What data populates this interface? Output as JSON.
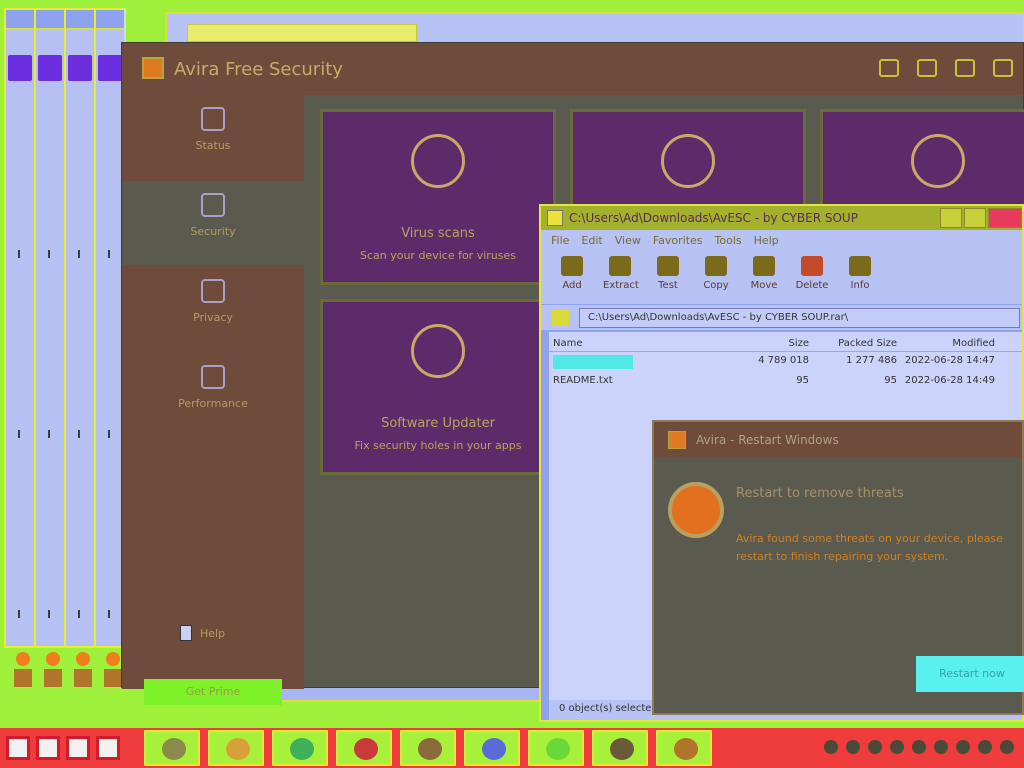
{
  "background_window": {
    "tab_title": "",
    "status_line": ""
  },
  "avira": {
    "title": "Avira Free Security",
    "nav": [
      {
        "label": "Status",
        "icon": "search-shield-icon"
      },
      {
        "label": "Security",
        "icon": "shield-icon"
      },
      {
        "label": "Privacy",
        "icon": "fingerprint-icon"
      },
      {
        "label": "Performance",
        "icon": "rocket-icon"
      }
    ],
    "help_label": "Help",
    "upgrade_label": "Get Prime",
    "tiles": [
      {
        "title": "Virus scans",
        "subtitle": "Scan your device for viruses",
        "icon": "magnifier-check-icon"
      },
      {
        "title": "",
        "subtitle": "",
        "icon": "hexagons-icon"
      },
      {
        "title": "",
        "subtitle": "",
        "icon": "firewall-icon"
      },
      {
        "title": "Software Updater",
        "subtitle": "Fix security holes in your apps",
        "icon": "refresh-icon"
      }
    ]
  },
  "file_manager": {
    "title": "C:\\Users\\Ad\\Downloads\\AvESC - by CYBER SOUP",
    "menu": [
      "File",
      "Edit",
      "View",
      "Favorites",
      "Tools",
      "Help"
    ],
    "tools": [
      {
        "label": "Add",
        "icon": "plus-icon",
        "color": "#6b4a1a"
      },
      {
        "label": "Extract",
        "icon": "minus-icon",
        "color": "#6b4a1a"
      },
      {
        "label": "Test",
        "icon": "check-icon",
        "color": "#6b4a1a"
      },
      {
        "label": "Copy",
        "icon": "arrow-copy-icon",
        "color": "#6b4a1a"
      },
      {
        "label": "Move",
        "icon": "arrow-move-icon",
        "color": "#6b4a1a"
      },
      {
        "label": "Delete",
        "icon": "delete-x-icon",
        "color": "#c44a2a"
      },
      {
        "label": "Info",
        "icon": "info-icon",
        "color": "#6b4a1a"
      }
    ],
    "address": "C:\\Users\\Ad\\Downloads\\AvESC - by CYBER SOUP.rar\\",
    "columns": [
      "Name",
      "Size",
      "Packed Size",
      "Modified"
    ],
    "rows": [
      {
        "name": "",
        "size": "4 789 018",
        "packed": "1 277 486",
        "modified": "2022-06-28 14:47"
      },
      {
        "name": "README.txt",
        "size": "95",
        "packed": "95",
        "modified": "2022-06-28 14:49"
      }
    ],
    "status": "0 object(s) selected"
  },
  "dialog": {
    "title": "Avira - Restart Windows",
    "heading": "Restart to remove threats",
    "body": "Avira found some threats on your device, please restart to finish repairing your system.",
    "button": "Restart now"
  },
  "taskbar": {
    "apps": [
      "file-explorer-icon",
      "browser-icon",
      "refresh-app-icon",
      "chrome-icon",
      "network-icon",
      "sync-icon",
      "green-app-icon",
      "dark-app-icon",
      "orange-app-icon"
    ]
  }
}
